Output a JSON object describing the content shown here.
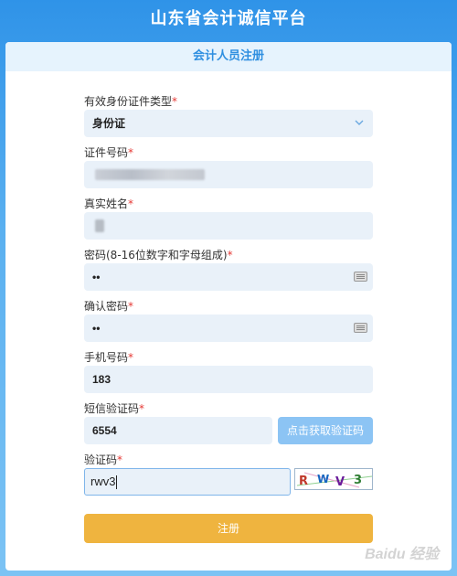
{
  "app": {
    "title": "山东省会计诚信平台"
  },
  "form": {
    "title": "会计人员注册",
    "fields": {
      "id_type": {
        "label": "有效身份证件类型",
        "value": "身份证"
      },
      "id_number": {
        "label": "证件号码",
        "value": ""
      },
      "real_name": {
        "label": "真实姓名",
        "value": ""
      },
      "password": {
        "label": "密码(8-16位数字和字母组成)",
        "value": "••"
      },
      "confirm_password": {
        "label": "确认密码",
        "value": "••"
      },
      "phone": {
        "label": "手机号码",
        "value": "183"
      },
      "sms_code": {
        "label": "短信验证码",
        "value": "6554",
        "button_label": "点击获取验证码"
      },
      "captcha": {
        "label": "验证码",
        "value": "rwv3",
        "image_text": "R W V 3"
      }
    },
    "required_mark": "*",
    "submit_label": "注册"
  },
  "icons": {
    "select_chevron": "chevron-down-icon",
    "keyboard": "keyboard-icon"
  },
  "watermark": {
    "text": "Baidu 经验"
  },
  "colors": {
    "header_bg": "#2f93e8",
    "accent": "#2f8fe0",
    "input_bg": "#e9f1f9",
    "submit": "#efb43f",
    "sms_button": "#8cc4f4",
    "required": "#e53935"
  }
}
